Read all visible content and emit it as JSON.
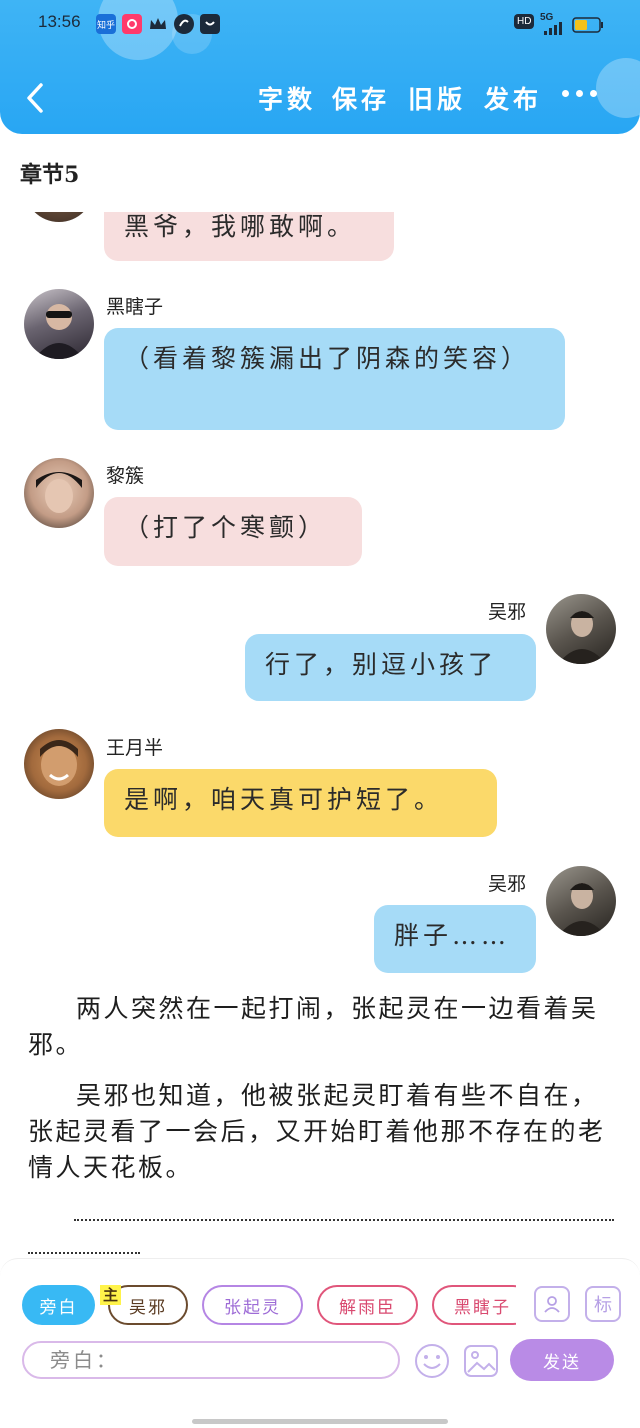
{
  "status_bar": {
    "time": "13:56",
    "app_icons": [
      "知乎",
      "",
      "",
      "",
      ""
    ],
    "right": {
      "hd": "HD",
      "network": "5G"
    }
  },
  "header": {
    "menu": [
      "字数",
      "保存",
      "旧版",
      "发布"
    ]
  },
  "chapter": {
    "title": "章节5"
  },
  "messages": [
    {
      "speaker": "",
      "side": "left",
      "text": "黑爷，我哪敢啊。",
      "color": "pink"
    },
    {
      "speaker": "黑瞎子",
      "side": "left",
      "text": "（看着黎簇漏出了阴森的笑容）",
      "color": "blue"
    },
    {
      "speaker": "黎簇",
      "side": "left",
      "text": "（打了个寒颤）",
      "color": "pink"
    },
    {
      "speaker": "吴邪",
      "side": "right",
      "text": "行了，别逗小孩了",
      "color": "blue"
    },
    {
      "speaker": "王月半",
      "side": "left",
      "text": "是啊，咱天真可护短了。",
      "color": "yellow"
    },
    {
      "speaker": "吴邪",
      "side": "right",
      "text": "胖子……",
      "color": "blue"
    }
  ],
  "narration": [
    "两人突然在一起打闹，张起灵在一边看着吴邪。",
    "吴邪也知道，他被张起灵盯着有些不自在，张起灵看了一会后，又开始盯着他那不存在的老情人天花板。"
  ],
  "composer": {
    "chips": [
      "旁白",
      "吴邪",
      "张起灵",
      "解雨臣",
      "黑瞎子"
    ],
    "main_badge": "主",
    "tool_label": "标",
    "input_value": "旁白：",
    "send_label": "发送"
  },
  "colors": {
    "header": "#28a6f3",
    "bubble_pink": "#f7dede",
    "bubble_blue": "#a6dbf7",
    "bubble_yellow": "#fbd96a",
    "send": "#b98be6"
  },
  "icons": [
    "back-arrow-icon",
    "more-icon",
    "person-card-icon",
    "emoji-icon",
    "image-icon"
  ]
}
